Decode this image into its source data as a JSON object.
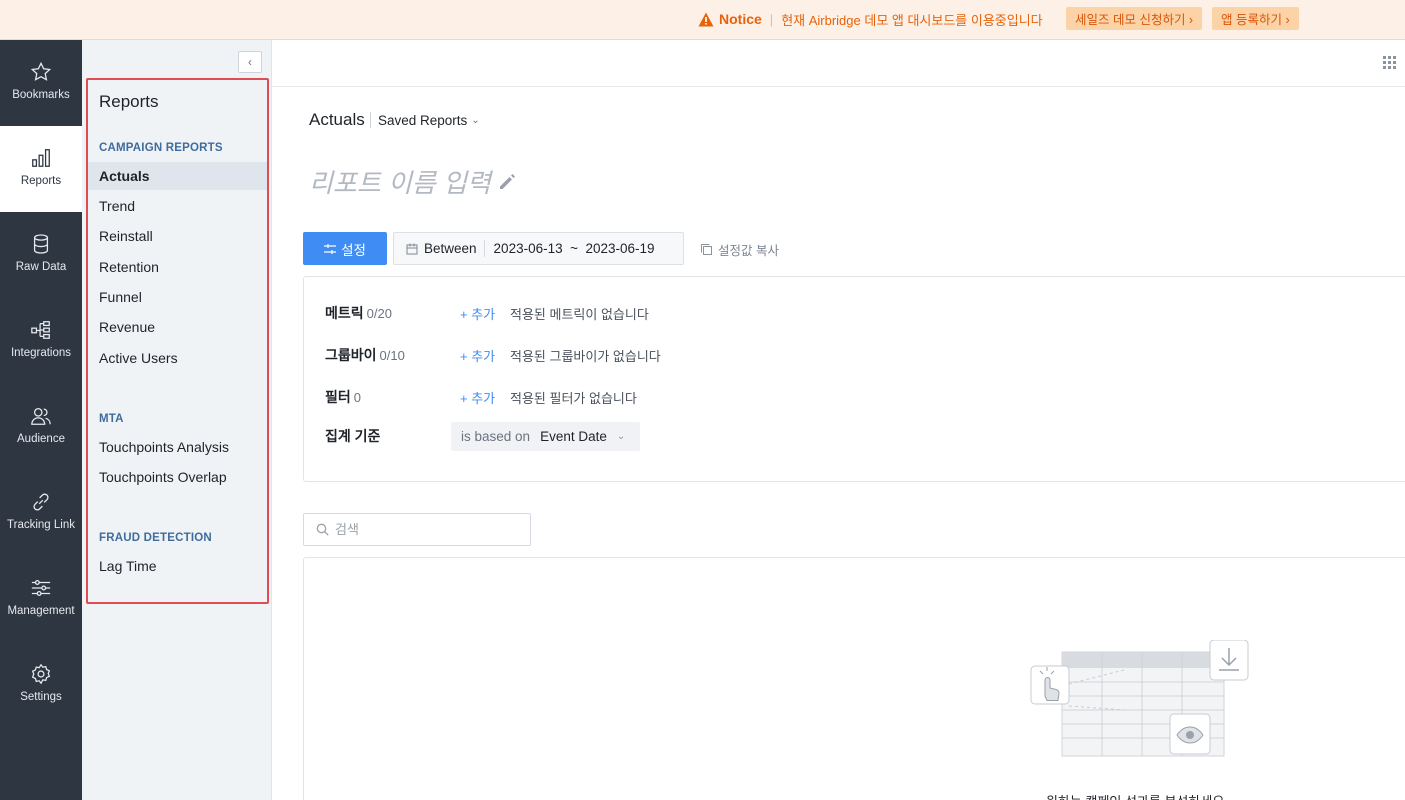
{
  "notice": {
    "label": "Notice",
    "separator": "|",
    "message": "현재 Airbridge 데모 앱 대시보드를 이용중입니다",
    "sales_demo_button": "세일즈 데모 신청하기 ›",
    "register_app_button": "앱 등록하기 ›",
    "icon": "warning-triangle-icon"
  },
  "rail": {
    "items": [
      {
        "label": "Bookmarks",
        "icon": "star-icon"
      },
      {
        "label": "Reports",
        "icon": "bar-chart-icon"
      },
      {
        "label": "Raw Data",
        "icon": "database-icon"
      },
      {
        "label": "Integrations",
        "icon": "integration-icon"
      },
      {
        "label": "Audience",
        "icon": "users-icon"
      },
      {
        "label": "Tracking Link",
        "icon": "link-icon"
      },
      {
        "label": "Management",
        "icon": "sliders-icon"
      },
      {
        "label": "Settings",
        "icon": "gear-icon"
      }
    ],
    "active": "Reports"
  },
  "subnav": {
    "collapse_symbol": "‹",
    "title": "Reports",
    "sections": [
      {
        "title": "CAMPAIGN REPORTS",
        "items": [
          "Actuals",
          "Trend",
          "Reinstall",
          "Retention",
          "Funnel",
          "Revenue",
          "Active Users"
        ]
      },
      {
        "title": "MTA",
        "items": [
          "Touchpoints Analysis",
          "Touchpoints Overlap"
        ]
      },
      {
        "title": "FRAUD DETECTION",
        "items": [
          "Lag Time"
        ]
      }
    ],
    "active_item": "Actuals"
  },
  "main": {
    "breadcrumb": {
      "current": "Actuals",
      "saved_reports": "Saved Reports"
    },
    "report_name_placeholder": "리포트 이름 입력",
    "settings_button": "설정",
    "date_range": {
      "mode": "Between",
      "value": "2023-06-13  ~  2023-06-19"
    },
    "copy_settings": "설정값 복사",
    "settings_rows": [
      {
        "label": "메트릭",
        "count": "0/20",
        "add": "+ 추가",
        "empty": "적용된 메트릭이 없습니다"
      },
      {
        "label": "그룹바이",
        "count": "0/10",
        "add": "+ 추가",
        "empty": "적용된 그룹바이가 없습니다"
      },
      {
        "label": "필터",
        "count": "0",
        "add": "+ 추가",
        "empty": "적용된 필터가 없습니다"
      }
    ],
    "aggregation": {
      "label": "집계 기준",
      "prefix": "is based on",
      "value": "Event Date"
    },
    "search_placeholder": "검색",
    "empty_caption": "원하는 캠페인 성과를 분석하세요"
  },
  "colors": {
    "accent": "#3f8cf4",
    "notice": "#e8620a",
    "rail_bg": "#2d3641",
    "highlight_border": "#e04b54"
  }
}
